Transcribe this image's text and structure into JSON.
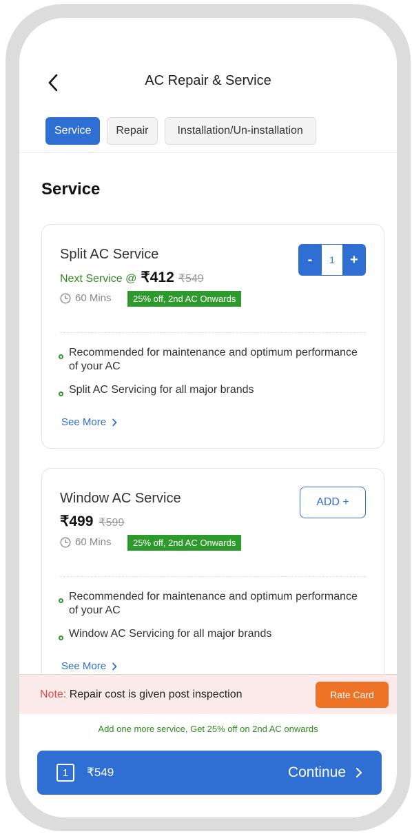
{
  "header": {
    "title": "AC Repair & Service",
    "tabs": [
      {
        "label": "Service",
        "active": true
      },
      {
        "label": "Repair",
        "active": false
      },
      {
        "label": "Installation/Un-installation",
        "active": false
      }
    ]
  },
  "section_title": "Service",
  "cards": [
    {
      "name": "Split AC Service",
      "next_label": "Next Service @",
      "price": "₹412",
      "original_price": "₹549",
      "duration": "60 Mins",
      "badge": "25% off, 2nd AC Onwards",
      "bullets": [
        "Recommended for maintenance and optimum performance of your AC",
        "Split AC Servicing for all major brands"
      ],
      "see_more": "See More",
      "quantity": "1",
      "minus_label": "-",
      "plus_label": "+"
    },
    {
      "name": "Window AC Service",
      "price": "₹499",
      "original_price": "₹599",
      "duration": "60 Mins",
      "badge": "25% off, 2nd AC Onwards",
      "bullets": [
        "Recommended for maintenance and optimum performance of your AC",
        "Window AC Servicing for all major brands"
      ],
      "see_more": "See More",
      "add_label": "ADD +"
    }
  ],
  "note": {
    "label": "Note:",
    "text": " Repair cost is given post inspection",
    "rate_card_label": "Rate Card"
  },
  "offer_text": "Add one more service, Get 25% off on 2nd AC onwards",
  "footer": {
    "count": "1",
    "total": "₹549",
    "continue_label": "Continue"
  },
  "colors": {
    "accent": "#2f6fd3",
    "success": "#2e9a2e",
    "warning": "#ee7326",
    "note_bg": "#fbeaea"
  }
}
